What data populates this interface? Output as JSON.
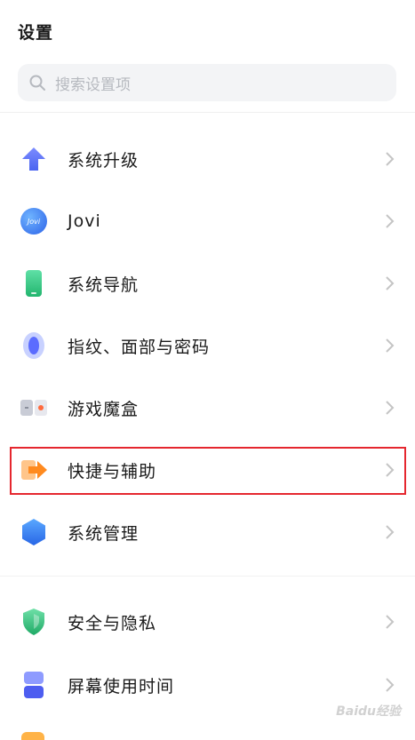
{
  "header": {
    "title": "设置"
  },
  "search": {
    "placeholder": "搜索设置项"
  },
  "items": [
    {
      "label": "系统升级",
      "icon": "arrow-up-icon"
    },
    {
      "label": "Jovi",
      "icon": "jovi-icon",
      "badge": "Jovi"
    },
    {
      "label": "系统导航",
      "icon": "phone-icon"
    },
    {
      "label": "指纹、面部与密码",
      "icon": "fingerprint-icon"
    },
    {
      "label": "游戏魔盒",
      "icon": "game-box-icon"
    },
    {
      "label": "快捷与辅助",
      "icon": "shortcut-arrow-icon"
    },
    {
      "label": "系统管理",
      "icon": "hexagon-icon"
    },
    {
      "label": "安全与隐私",
      "icon": "shield-icon"
    },
    {
      "label": "屏幕使用时间",
      "icon": "hourglass-icon"
    }
  ],
  "watermark": "Baidu经验",
  "colors": {
    "highlight": "#e5272f",
    "accent": "#4a7dff"
  }
}
